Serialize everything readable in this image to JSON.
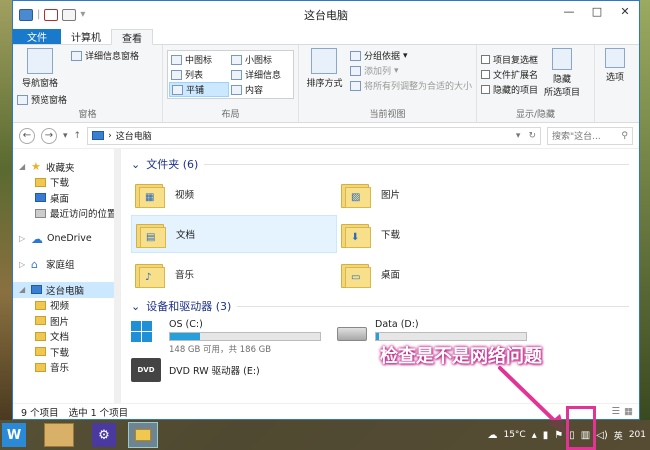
{
  "window": {
    "title": "这台电脑",
    "controls": {
      "minimize": "—",
      "maximize": "□",
      "close": "✕"
    }
  },
  "ribbon": {
    "tabs": [
      "文件",
      "计算机",
      "查看"
    ],
    "panes": {
      "label": "窗格",
      "nav_pane": "导航窗格",
      "preview_pane": "预览窗格",
      "details_pane": "详细信息窗格"
    },
    "layout": {
      "label": "布局",
      "items": [
        "中图标",
        "小图标",
        "列表",
        "详细信息",
        "平铺",
        "内容"
      ]
    },
    "current_view": {
      "label": "当前视图",
      "sort": "排序方式",
      "group_by": "分组依据",
      "add_column": "添加列",
      "fit_columns": "将所有列调整为合适的大小"
    },
    "show_hide": {
      "label": "显示/隐藏",
      "item_checkbox": "项目复选框",
      "file_ext": "文件扩展名",
      "hidden_items": "隐藏的项目",
      "hide_selected_1": "隐藏",
      "hide_selected_2": "所选项目"
    },
    "options": "选项"
  },
  "address": {
    "path": "这台电脑",
    "search_placeholder": "搜索\"这台..."
  },
  "nav": {
    "favorites": "收藏夹",
    "downloads": "下载",
    "desktop": "桌面",
    "recent": "最近访问的位置",
    "onedrive": "OneDrive",
    "homegroup": "家庭组",
    "this_pc": "这台电脑",
    "videos": "视频",
    "pictures": "图片",
    "documents": "文档",
    "downloads2": "下载",
    "music": "音乐"
  },
  "main": {
    "folders_header": "文件夹 (6)",
    "folders": [
      "视频",
      "图片",
      "文档",
      "下载",
      "音乐",
      "桌面"
    ],
    "devices_header": "设备和驱动器 (3)",
    "drives": [
      {
        "name": "OS (C:)",
        "free": "148 GB 可用，共 186 GB",
        "used_fraction": 0.2
      },
      {
        "name": "Data (D:)",
        "free": "",
        "used_fraction": 0.02
      }
    ],
    "dvd": "DVD RW 驱动器 (E:)",
    "dvd_badge": "DVD"
  },
  "status": {
    "count": "9 个项目",
    "selected": "选中 1 个项目"
  },
  "annotation": "检查是不是网络问题",
  "taskbar": {
    "start": "W",
    "weather": "15°C",
    "lang": "英",
    "clock": "201"
  },
  "colors": {
    "accent": "#1979ca",
    "annotation": "#e23495"
  }
}
